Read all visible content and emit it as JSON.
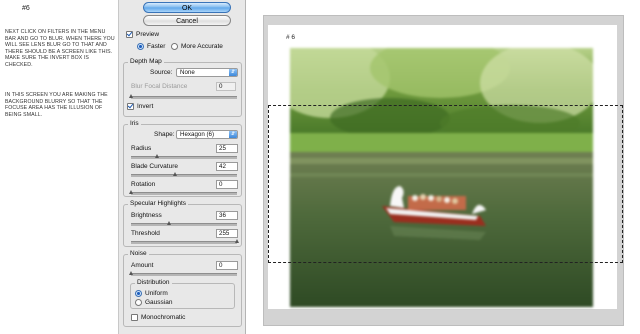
{
  "notes": {
    "header": "#6",
    "paragraph_1": "Next click on filters in the menu bar and go to blur. When there you will see Lens blur go to that and there should be a screen like this. Make sure the invert box is checked.",
    "paragraph_2": "In this screen you are making the background blurry so that the focuse area has the illusion of being small."
  },
  "dialog": {
    "ok_label": "OK",
    "cancel_label": "Cancel",
    "preview": {
      "label": "Preview",
      "checked": true
    },
    "mode": {
      "faster_label": "Faster",
      "accurate_label": "More Accurate",
      "selected": "Faster"
    },
    "depth_map": {
      "title": "Depth Map",
      "source_label": "Source:",
      "source_value": "None",
      "blur_focal_label": "Blur Focal Distance",
      "blur_focal_value": "0",
      "invert_label": "Invert",
      "invert_checked": true
    },
    "iris": {
      "title": "Iris",
      "shape_label": "Shape:",
      "shape_value": "Hexagon (6)",
      "radius_label": "Radius",
      "radius_value": "25",
      "curvature_label": "Blade Curvature",
      "curvature_value": "42",
      "rotation_label": "Rotation",
      "rotation_value": "0"
    },
    "specular": {
      "title": "Specular Highlights",
      "brightness_label": "Brightness",
      "brightness_value": "36",
      "threshold_label": "Threshold",
      "threshold_value": "255"
    },
    "noise": {
      "title": "Noise",
      "amount_label": "Amount",
      "amount_value": "0",
      "distribution_title": "Distribution",
      "uniform_label": "Uniform",
      "gaussian_label": "Gaussian",
      "selected": "Uniform",
      "mono_label": "Monochromatic",
      "mono_checked": false
    }
  },
  "preview_canvas": {
    "header": "# 6"
  },
  "colors": {
    "accent": "#5ea6ea",
    "panel_bg": "#e8e8e8"
  },
  "icons": {
    "dropdown": "chevron-updown-icon",
    "checkbox": "checkmark-icon",
    "slider_thumb": "triangle-thumb-icon"
  }
}
